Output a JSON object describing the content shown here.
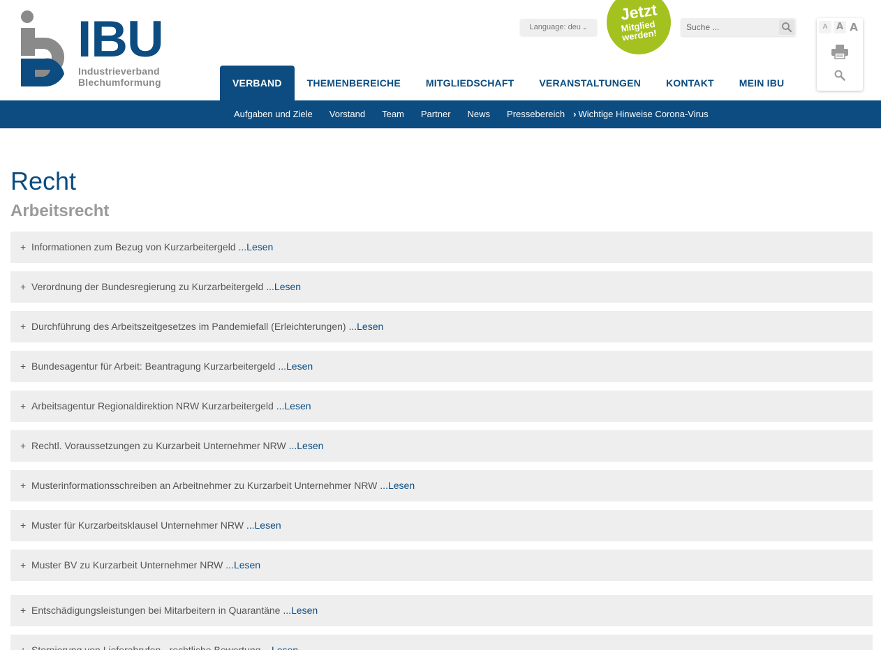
{
  "brand": {
    "name": "IBU",
    "sub_line1": "Industrieverband",
    "sub_line2": "Blechumformung",
    "primary_color": "#0c4c80",
    "accent_color": "#a3c21f"
  },
  "header": {
    "language_label": "Language: deu",
    "badge_line1": "Jetzt",
    "badge_line2": "Mitglied",
    "badge_line3": "werden!",
    "search_placeholder": "Suche ...",
    "font_small": "A",
    "font_medium": "A",
    "font_large": "A"
  },
  "main_nav": [
    {
      "label": "VERBAND",
      "active": true
    },
    {
      "label": "THEMENBEREICHE",
      "active": false
    },
    {
      "label": "MITGLIEDSCHAFT",
      "active": false
    },
    {
      "label": "VERANSTALTUNGEN",
      "active": false
    },
    {
      "label": "KONTAKT",
      "active": false
    },
    {
      "label": "MEIN IBU",
      "active": false
    }
  ],
  "sub_nav": [
    {
      "label": "Aufgaben und Ziele"
    },
    {
      "label": "Vorstand"
    },
    {
      "label": "Team"
    },
    {
      "label": "Partner"
    },
    {
      "label": "News"
    },
    {
      "label": "Pressebereich"
    },
    {
      "label": "Wichtige Hinweise Corona-Virus"
    }
  ],
  "page": {
    "title": "Recht",
    "section": "Arbeitsrecht"
  },
  "accordion": {
    "more_label": "...Lesen",
    "items": [
      {
        "label": "Informationen zum Bezug von Kurzarbeitergeld"
      },
      {
        "label": "Verordnung der Bundesregierung zu Kurzarbeitergeld"
      },
      {
        "label": "Durchführung des Arbeitszeitgesetzes im Pandemiefall (Erleichterungen)"
      },
      {
        "label": "Bundesagentur für Arbeit: Beantragung Kurzarbeitergeld"
      },
      {
        "label": "Arbeitsagentur Regionaldirektion NRW Kurzarbeitergeld"
      },
      {
        "label": "Rechtl. Voraussetzungen zu Kurzarbeit Unternehmer NRW"
      },
      {
        "label": "Musterinformationsschreiben an Arbeitnehmer zu Kurzarbeit Unternehmer NRW"
      },
      {
        "label": "Muster für Kurzarbeitsklausel Unternehmer NRW"
      },
      {
        "label": "Muster BV zu Kurzarbeit Unternehmer NRW"
      },
      {
        "label": "Entschädigungsleistungen bei Mitarbeitern in Quarantäne"
      },
      {
        "label": "Stornierung von Lieferabrufen - rechtliche Bewertung"
      }
    ]
  }
}
